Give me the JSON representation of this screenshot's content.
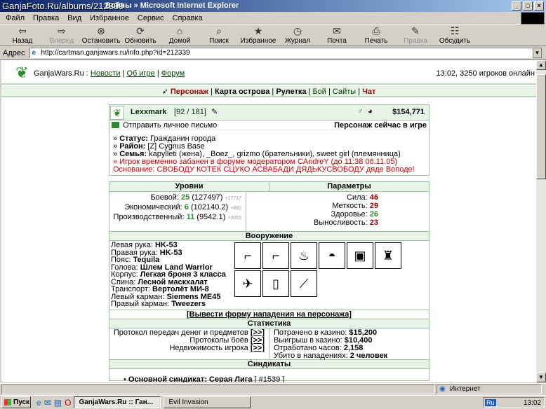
{
  "window": {
    "watermark": "GanjaFoto.Ru/albums/212339",
    "title": "Войны » Microsoft Internet Explorer"
  },
  "menu": [
    "Файл",
    "Правка",
    "Вид",
    "Избранное",
    "Сервис",
    "Справка"
  ],
  "toolbar": [
    {
      "label": "Назад",
      "icon": "back-arrow-icon",
      "disabled": false
    },
    {
      "label": "Вперед",
      "icon": "forward-arrow-icon",
      "disabled": true
    },
    {
      "label": "Остановить",
      "icon": "stop-icon",
      "disabled": false
    },
    {
      "label": "Обновить",
      "icon": "refresh-icon",
      "disabled": false
    },
    {
      "label": "Домой",
      "icon": "home-icon",
      "disabled": false
    },
    {
      "label": "Поиск",
      "icon": "search-icon",
      "disabled": false
    },
    {
      "label": "Избранное",
      "icon": "favorites-icon",
      "disabled": false
    },
    {
      "label": "Журнал",
      "icon": "history-icon",
      "disabled": false
    },
    {
      "label": "Почта",
      "icon": "mail-icon",
      "disabled": false
    },
    {
      "label": "Печать",
      "icon": "print-icon",
      "disabled": false
    },
    {
      "label": "Правка",
      "icon": "edit-icon",
      "disabled": true
    },
    {
      "label": "Обсудить",
      "icon": "discuss-icon",
      "disabled": false
    }
  ],
  "address": {
    "label": "Адрес",
    "url": "http://cartman.ganjawars.ru/info.php?id=212339"
  },
  "site": {
    "brand": "GanjaWars.Ru",
    "links": [
      "Новости",
      "Об игре",
      "Форум"
    ],
    "online": "13:02, 3250 игроков онлайн",
    "nav": [
      {
        "label": "Персонаж",
        "style": "r"
      },
      {
        "label": "Карта острова",
        "style": "b"
      },
      {
        "label": "Рулетка",
        "style": "b"
      },
      {
        "label": "Бой",
        "style": "n"
      },
      {
        "label": "Сайты",
        "style": "n"
      },
      {
        "label": "Чат",
        "style": "r"
      }
    ]
  },
  "player": {
    "nick": "Lexxmark",
    "level": "[92 / 181]",
    "money": "$154,771",
    "send_mail": "Отправить личное письмо",
    "in_game": "Персонаж сейчас в игре",
    "status_label": "Статус:",
    "status": "Гражданин города",
    "district_label": "Район:",
    "district": "[Z] Cygnus Base",
    "family_label": "Семья:",
    "family": "kapylleti (жена), _Boez_, grizmo (брательники), sweet girl (племянница)",
    "ban": "» Игрок временно забанен в форуме модератором CAndreY (до 11:38 06.11.05)",
    "reason": "Основание: СВОБОДУ КОТЕК СЦУКО АСВАБАДИ ДЯДЬКУСВОБОДУ дяде Воподе!"
  },
  "levels": {
    "title": "Уровни",
    "rows": [
      {
        "label": "Боевой:",
        "value": "25",
        "detail": "(127497)",
        "extra": "+17717"
      },
      {
        "label": "Экономический:",
        "value": "6",
        "detail": "(102140.2)",
        "extra": "+892"
      },
      {
        "label": "Производственный:",
        "value": "11",
        "detail": "(9542.1)",
        "extra": "+3055"
      }
    ]
  },
  "params": {
    "title": "Параметры",
    "rows": [
      {
        "label": "Сила:",
        "value": "46"
      },
      {
        "label": "Меткость:",
        "value": "29"
      },
      {
        "label": "Здоровье:",
        "value": "26"
      },
      {
        "label": "Выносливость:",
        "value": "23"
      }
    ]
  },
  "weapons": {
    "title": "Вооружение",
    "items": [
      {
        "slot": "Левая рука:",
        "item": "HK-53"
      },
      {
        "slot": "Правая рука:",
        "item": "HK-53"
      },
      {
        "slot": "Пояс:",
        "item": "Tequila"
      },
      {
        "slot": "Голова:",
        "item": "Шлем Land Warrior"
      },
      {
        "slot": "Корпус:",
        "item": "Легкая броня 3 класса"
      },
      {
        "slot": "Спина:",
        "item": "Лесной маскхалат"
      },
      {
        "slot": "Транспорт:",
        "item": "Вертолёт МИ-8"
      },
      {
        "slot": "Левый карман:",
        "item": "Siemens ME45"
      },
      {
        "slot": "Правый карман:",
        "item": "Tweezers"
      }
    ],
    "images": [
      {
        "icon": "rifle-icon",
        "glyph": "⌐"
      },
      {
        "icon": "rifle-icon",
        "glyph": "⌐"
      },
      {
        "icon": "bottle-icon",
        "glyph": "♨"
      },
      {
        "icon": "helmet-icon",
        "glyph": "◓"
      },
      {
        "icon": "armor-icon",
        "glyph": "▣"
      },
      {
        "icon": "camo-suit-icon",
        "glyph": "♜"
      },
      {
        "icon": "helicopter-icon",
        "glyph": "✈"
      },
      {
        "icon": "phone-icon",
        "glyph": "▯"
      },
      {
        "icon": "tweezers-icon",
        "glyph": "⟋"
      }
    ],
    "attack": "[Вывести форму нападения на персонажа]"
  },
  "stats": {
    "title": "Статистика",
    "left": [
      {
        "label": "Протокол передач денег и предметов",
        "link": "[>>]"
      },
      {
        "label": "Протоколы боёв",
        "link": "[>>]"
      },
      {
        "label": "Недвижимость игрока",
        "link": "[>>]"
      }
    ],
    "right": [
      {
        "label": "Потрачено в казино:",
        "value": "$15,200"
      },
      {
        "label": "Выигрыш в казино:",
        "value": "$10,400"
      },
      {
        "label": "Отработано часов:",
        "value": "2,158"
      },
      {
        "label": "Убито в нападениях:",
        "value": "2 человек"
      }
    ]
  },
  "syndicates": {
    "title": "Синдикаты",
    "main_label": "Основной синдикат:",
    "main": "Серая Лига",
    "main_id": "[ #1539 ]"
  },
  "statusbar": {
    "zone": "Интернет"
  },
  "taskbar": {
    "start": "Пуск",
    "tasks": [
      "GanjaWars.Ru :: Ган...",
      "Evil Invasion"
    ],
    "lang": "Ru",
    "clock": "13:02"
  }
}
